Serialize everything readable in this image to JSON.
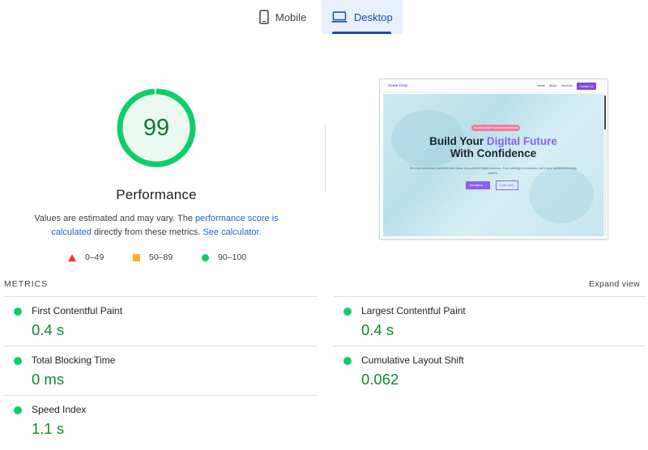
{
  "tabs": {
    "mobile": {
      "label": "Mobile",
      "icon": "smartphone-icon"
    },
    "desktop": {
      "label": "Desktop",
      "icon": "laptop-icon",
      "selected": true
    }
  },
  "performance": {
    "score": "99",
    "title": "Performance",
    "desc_prefix": "Values are estimated and may vary. The ",
    "score_link": "performance score is calculated",
    "desc_mid": " directly from these metrics. ",
    "calc_link": "See calculator.",
    "score_fraction": 0.99,
    "colors": {
      "pass": "#0cce6b",
      "pass_text": "#0c8a2d",
      "average": "#ffaa33",
      "fail": "#ff3333"
    }
  },
  "legend": {
    "fail": "0–49",
    "average": "50–89",
    "pass": "90–100"
  },
  "thumbnail": {
    "logo": "Acme Corp",
    "nav_links": [
      "Home",
      "About",
      "Services"
    ],
    "cta": "Contact Us",
    "badge": "Trusted by 500+ businesses worldwide",
    "headline_part1": "Build Your ",
    "headline_accent": "Digital Future",
    "headline_part2": "With Confidence",
    "subtext": "We help businesses transform their ideas into powerful digital solutions. From strategy to execution, we're your trusted technology partner.",
    "primary_button": "Get started →",
    "secondary_button": "Learn more"
  },
  "metrics": {
    "header": "METRICS",
    "expand": "Expand view",
    "fcp": {
      "label": "First Contentful Paint",
      "value": "0.4 s"
    },
    "lcp": {
      "label": "Largest Contentful Paint",
      "value": "0.4 s"
    },
    "tbt": {
      "label": "Total Blocking Time",
      "value": "0 ms"
    },
    "cls": {
      "label": "Cumulative Layout Shift",
      "value": "0.062"
    },
    "si": {
      "label": "Speed Index",
      "value": "1.1 s"
    }
  }
}
